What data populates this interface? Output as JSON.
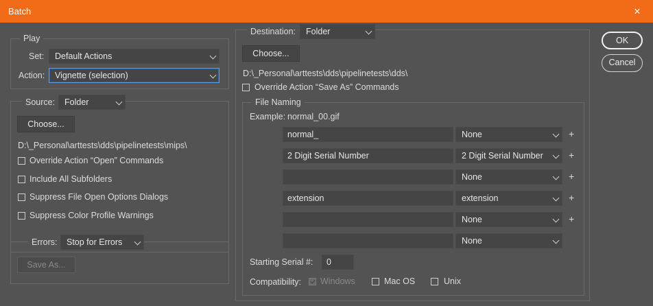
{
  "window": {
    "title": "Batch",
    "close_glyph": "✕"
  },
  "buttons": {
    "ok": "OK",
    "cancel": "Cancel"
  },
  "play": {
    "legend": "Play",
    "set_label": "Set:",
    "set_value": "Default Actions",
    "action_label": "Action:",
    "action_value": "Vignette (selection)"
  },
  "source": {
    "label": "Source:",
    "value": "Folder",
    "choose": "Choose...",
    "path": "D:\\_Personal\\arttests\\dds\\pipelinetests\\mips\\",
    "override_open": "Override Action “Open” Commands",
    "include_subfolders": "Include All Subfolders",
    "suppress_open": "Suppress File Open Options Dialogs",
    "suppress_color": "Suppress Color Profile Warnings"
  },
  "errors": {
    "label": "Errors:",
    "value": "Stop for Errors",
    "save_as": "Save As..."
  },
  "destination": {
    "label": "Destination:",
    "value": "Folder",
    "choose": "Choose...",
    "path": "D:\\_Personal\\arttests\\dds\\pipelinetests\\dds\\",
    "override_save": "Override Action “Save As” Commands"
  },
  "file_naming": {
    "legend": "File Naming",
    "example_label": "Example:",
    "example_value": "normal_00.gif",
    "rows": [
      {
        "text": "normal_",
        "option": "None",
        "plus": "+"
      },
      {
        "text": "2 Digit Serial Number",
        "option": "2 Digit Serial Number",
        "plus": "+"
      },
      {
        "text": "",
        "option": "None",
        "plus": "+"
      },
      {
        "text": "extension",
        "option": "extension",
        "plus": "+"
      },
      {
        "text": "",
        "option": "None",
        "plus": "+"
      },
      {
        "text": "",
        "option": "None",
        "plus": ""
      }
    ],
    "starting_serial_label": "Starting Serial #:",
    "starting_serial_value": "0",
    "compat_label": "Compatibility:",
    "windows": "Windows",
    "macos": "Mac OS",
    "unix": "Unix"
  }
}
